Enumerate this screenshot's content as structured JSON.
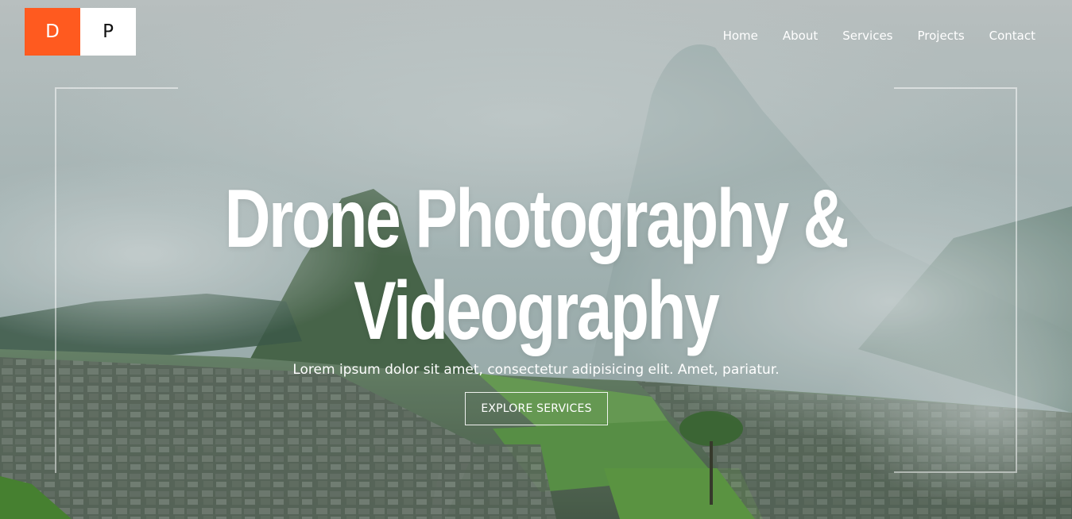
{
  "logo": {
    "letter_1": "D",
    "letter_2": "P",
    "accent_color": "#ff5a1f"
  },
  "nav": {
    "items": [
      {
        "label": "Home"
      },
      {
        "label": "About"
      },
      {
        "label": "Services"
      },
      {
        "label": "Projects"
      },
      {
        "label": "Contact"
      }
    ]
  },
  "hero": {
    "headline_line_1": "Drone Photography &",
    "headline_line_2": "Videography",
    "subtitle": "Lorem ipsum dolor sit amet, consectetur adipisicing elit. Amet, pariatur.",
    "cta_label": "EXPLORE SERVICES"
  }
}
